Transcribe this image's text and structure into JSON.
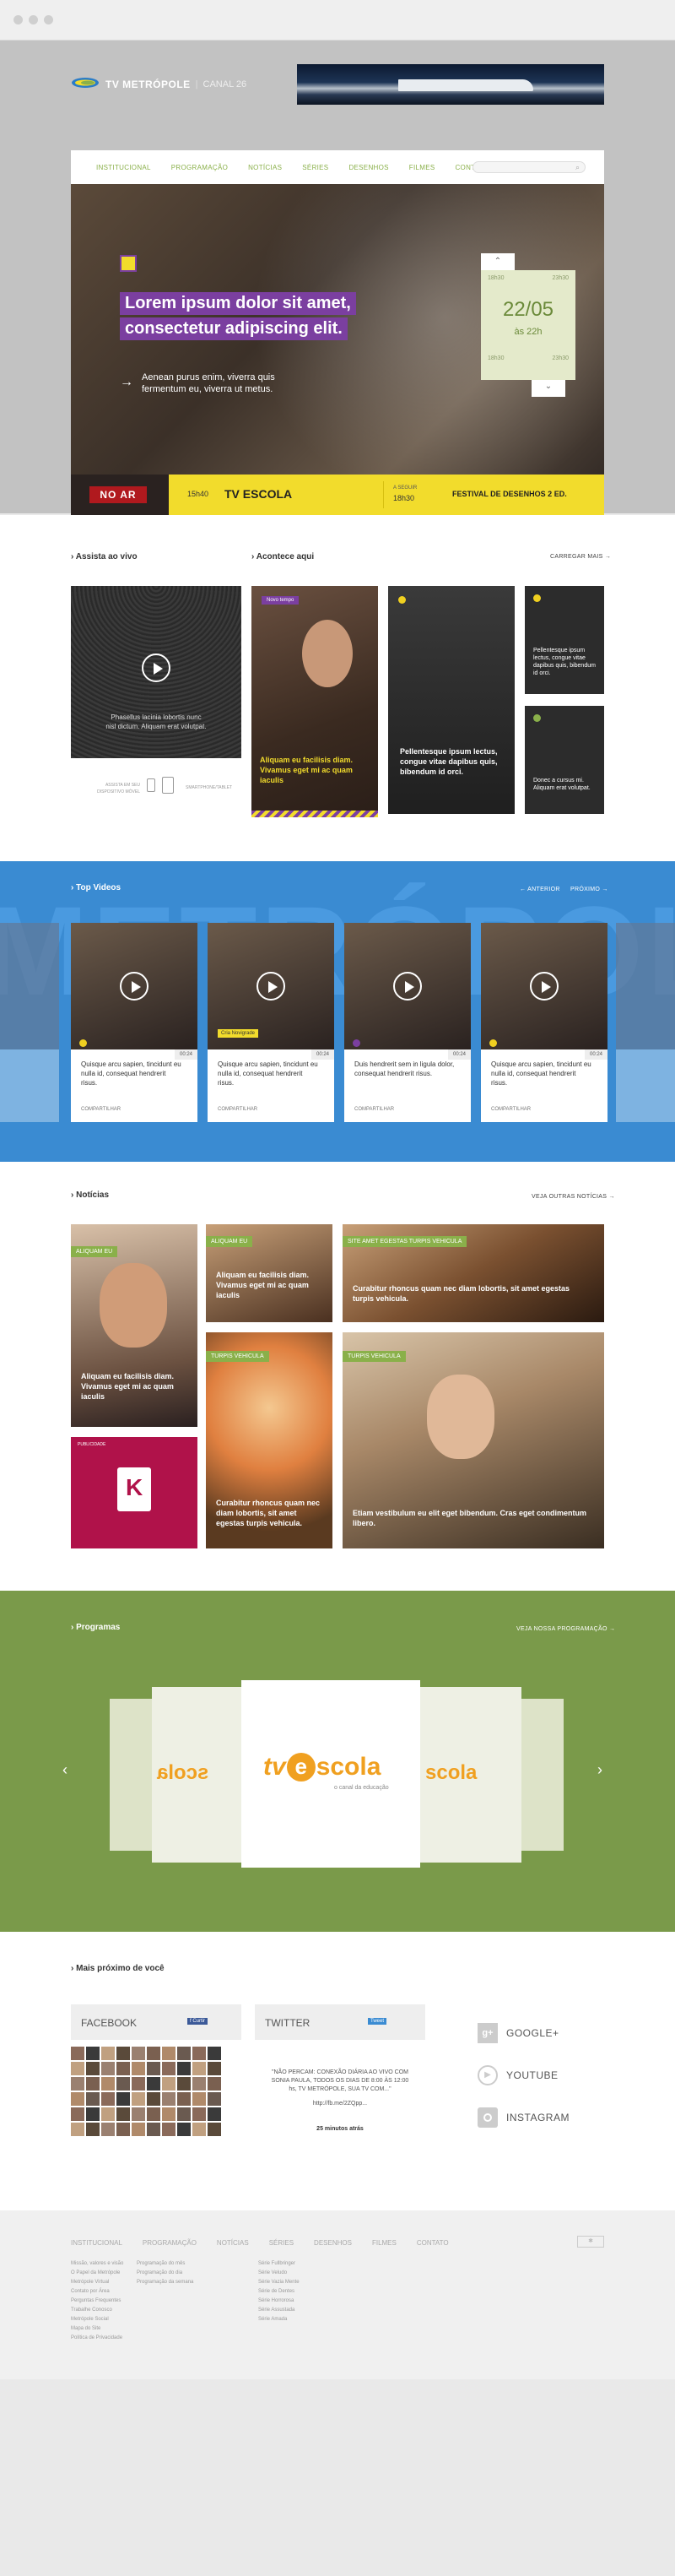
{
  "brand": {
    "name": "TV METRÓPOLE",
    "channel": "CANAL 26"
  },
  "nav": {
    "items": [
      "INSTITUCIONAL",
      "PROGRAMAÇÃO",
      "NOTÍCIAS",
      "SÉRIES",
      "DESENHOS",
      "FILMES",
      "CONTATO"
    ]
  },
  "hero": {
    "headline_1": "Lorem ipsum dolor sit amet,",
    "headline_2": "consectetur adipiscing elit.",
    "sub_1": "Aenean purus enim, viverra quis",
    "sub_2": "fermentum eu, viverra ut metus.",
    "schedule": {
      "t1": "18h30",
      "t2": "23h30",
      "date": "22/05",
      "time": "às 22h",
      "t3": "18h30",
      "t4": "23h30"
    }
  },
  "onair": {
    "badge": "NO AR",
    "time": "15h40",
    "title": "TV ESCOLA",
    "next_label": "A SEGUIR",
    "next_time": "18h30",
    "next_title": "FESTIVAL DE DESENHOS 2 ED."
  },
  "live": {
    "title": "Assista ao vivo",
    "caption_1": "Phasellus lacinia lobortis nunc",
    "caption_2": "nisl dictum. Aliquam erat volutpat.",
    "device_1": "ASSISTA EM SEU",
    "device_2": "DISPOSITIVO MÓVEL",
    "device_3": "SMARTPHONE/TABLET"
  },
  "happening": {
    "title": "Acontece aqui",
    "more": "CARREGAR MAIS",
    "tag": "Novo tempo",
    "card1": "Aliquam eu facilisis diam. Vivamus eget mi ac quam iaculis",
    "card2": "Pellentesque ipsum lectus, congue vitae dapibus quis, bibendum id orci.",
    "card3": "Pellentesque ipsum lectus, congue vitae dapibus quis, bibendum id orci.",
    "card4": "Donec a cursus mi. Aliquam erat volutpat."
  },
  "top_videos": {
    "title": "Top Videos",
    "prev": "ANTERIOR",
    "next": "PRÓXIMO",
    "watermark": "METRÓPOLE",
    "items": [
      {
        "text": "Quisque arcu sapien, tincidunt eu nulla id, consequat hendrerit risus.",
        "dur": "00:24",
        "share": "COMPARTILHAR",
        "badge": ""
      },
      {
        "text": "Quisque arcu sapien, tincidunt eu nulla id, consequat hendrerit risus.",
        "dur": "00:24",
        "share": "COMPARTILHAR",
        "badge": "Cria Novigrade"
      },
      {
        "text": "Duis hendrerit sem in ligula dolor, consequat hendrerit risus.",
        "dur": "00:24",
        "share": "COMPARTILHAR",
        "badge": ""
      },
      {
        "text": "Quisque arcu sapien, tincidunt eu nulla id, consequat hendrerit risus.",
        "dur": "00:24",
        "share": "COMPARTILHAR",
        "badge": ""
      }
    ]
  },
  "news": {
    "title": "Notícias",
    "more": "VEJA OUTRAS NOTÍCIAS",
    "n1_tag": "ALIQUAM EU",
    "n1": "Aliquam eu facilisis diam. Vivamus eget mi ac quam iaculis",
    "n2_tag": "ALIQUAM EU",
    "n2": "Aliquam eu facilisis diam. Vivamus eget mi ac quam iaculis",
    "n3_tag": "SITE AMET EGESTAS TURPIS VEHICULA",
    "n3": "Curabitur rhoncus quam nec diam lobortis, sit amet egestas turpis vehicula.",
    "n4_tag": "TURPIS VEHICULA",
    "n4": "Curabitur rhoncus quam nec diam lobortis, sit amet egestas turpis vehicula.",
    "n5_tag": "TURPIS VEHICULA",
    "n5": "Etiam vestibulum eu elit eget bibendum. Cras eget condimentum libero.",
    "ad_label": "PUBLICIDADE"
  },
  "programs": {
    "title": "Programas",
    "more": "VEJA NOSSA PROGRAMAÇÃO",
    "logo_tv": "tv",
    "logo_e": "e",
    "logo_scola": "scola",
    "logo_sub": "o canal da educação"
  },
  "social": {
    "title": "Mais próximo de você",
    "facebook": "FACEBOOK",
    "twitter": "TWITTER",
    "tweet": "\"NÃO PERCAM: CONEXÃO DIÁRIA AO VIVO COM SONIA PAULA, TODOS OS DIAS DE 8:00 ÀS 12:00 hs, TV METRÓPOLE, SUA TV COM...\"",
    "tweet_link": "http://fb.me/2ZQpp...",
    "tweet_time": "25 minutos atrás",
    "links": [
      "GOOGLE+",
      "YOUTUBE",
      "INSTAGRAM"
    ]
  },
  "footer": {
    "nav": [
      "INSTITUCIONAL",
      "PROGRAMAÇÃO",
      "NOTÍCIAS",
      "SÉRIES",
      "DESENHOS",
      "FILMES",
      "CONTATO"
    ],
    "col1": [
      "Missão, valores e visão",
      "O Papel da Metrópole",
      "Metrópole Virtual",
      "Contato por Área",
      "Perguntas Frequentes",
      "Trabalhe Conosco",
      "Metrópole Social",
      "Mapa do Site",
      "Política de Privacidade"
    ],
    "col2": [
      "Programação do mês",
      "Programação do dia",
      "Programação da semana"
    ],
    "col3": [
      "Série Fullbringer",
      "Série Veludo",
      "Série Vazia Mente",
      "Série de Dentes",
      "Série Horrorosa",
      "Série Assustada",
      "Série Amada"
    ]
  },
  "colors": {
    "green": "#8ab04a",
    "blue": "#3a8bd2",
    "purple": "#7b3fa0",
    "yellow": "#f2dc2c",
    "red": "#b0124a"
  }
}
